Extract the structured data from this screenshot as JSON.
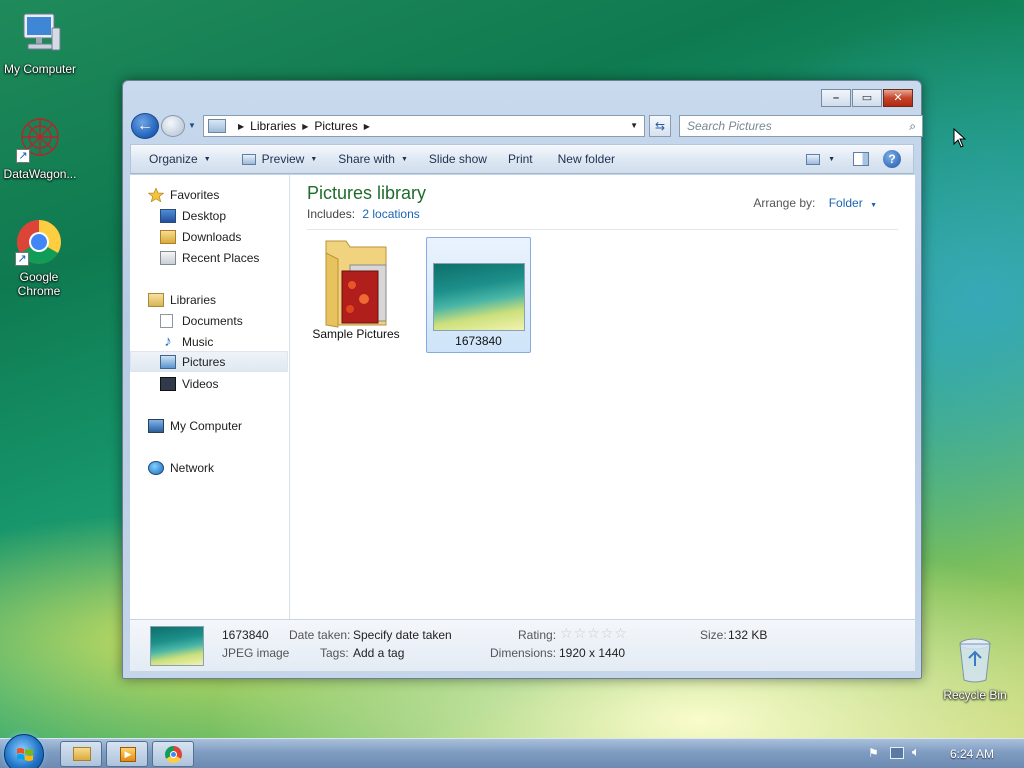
{
  "desktop": {
    "icons": [
      {
        "label": "My Computer"
      },
      {
        "label": "DataWagon..."
      },
      {
        "label": "Google Chrome"
      },
      {
        "label": "Recycle Bin"
      }
    ]
  },
  "window": {
    "address": {
      "crumbs": [
        "Libraries",
        "Pictures"
      ]
    },
    "search": {
      "placeholder": "Search Pictures"
    },
    "toolbar": {
      "organize": "Organize",
      "preview": "Preview",
      "share_with": "Share with",
      "slide_show": "Slide show",
      "print": "Print",
      "new_folder": "New folder",
      "help": "?"
    },
    "nav": {
      "favorites": "Favorites",
      "desktop": "Desktop",
      "downloads": "Downloads",
      "recent_places": "Recent Places",
      "libraries": "Libraries",
      "documents": "Documents",
      "music": "Music",
      "pictures": "Pictures",
      "videos": "Videos",
      "my_computer": "My Computer",
      "network": "Network"
    },
    "library": {
      "title": "Pictures library",
      "includes_label": "Includes:",
      "includes_link": "2 locations",
      "arrange_label": "Arrange by:",
      "arrange_value": "Folder"
    },
    "items": [
      {
        "label": "Sample Pictures",
        "type": "folder"
      },
      {
        "label": "1673840",
        "type": "image",
        "selected": true
      }
    ],
    "details": {
      "name": "1673840",
      "type": "JPEG image",
      "date_taken_label": "Date taken:",
      "date_taken_value": "Specify date taken",
      "tags_label": "Tags:",
      "tags_value": "Add a tag",
      "rating_label": "Rating:",
      "rating_value": 0,
      "rating_max": 5,
      "dimensions_label": "Dimensions:",
      "dimensions_value": "1920 x 1440",
      "size_label": "Size:",
      "size_value": "132 KB"
    }
  },
  "taskbar": {
    "clock": "6:24 AM"
  },
  "colors": {
    "library_title": "#1e6d2b",
    "link": "#1b63b4",
    "close_button": "#c4442a"
  }
}
